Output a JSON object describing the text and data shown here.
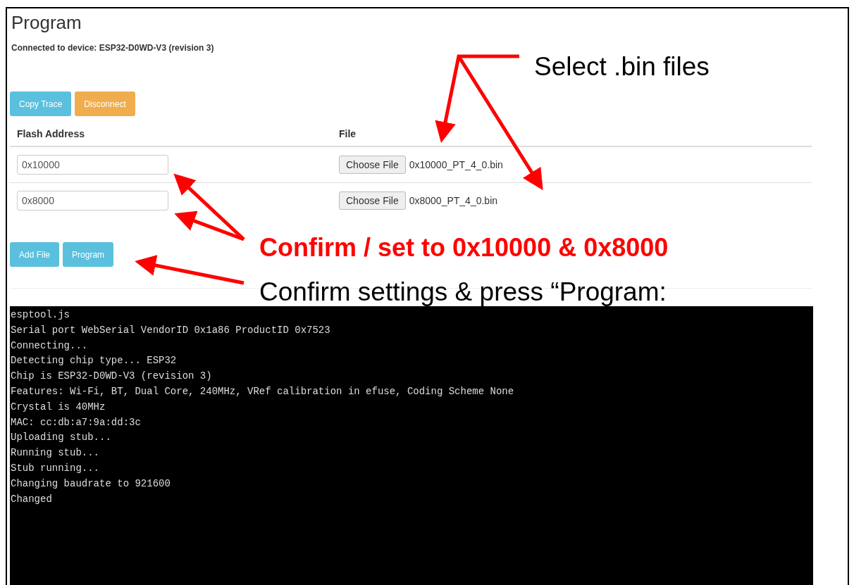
{
  "title": "Program",
  "connection_text": "Connected to device: ESP32-D0WD-V3 (revision 3)",
  "top_buttons": [
    {
      "label": "Copy Trace",
      "kind": "info"
    },
    {
      "label": "Disconnect",
      "kind": "warning"
    }
  ],
  "table": {
    "columns": [
      "Flash Address",
      "File"
    ],
    "rows": [
      {
        "address": "0x10000",
        "file_button": "Choose File",
        "file_name": "0x10000_PT_4_0.bin"
      },
      {
        "address": "0x8000",
        "file_button": "Choose File",
        "file_name": "0x8000_PT_4_0.bin"
      }
    ]
  },
  "bottom_buttons": [
    {
      "label": "Add File",
      "kind": "info"
    },
    {
      "label": "Program",
      "kind": "info"
    }
  ],
  "console_lines": [
    "esptool.js",
    "Serial port WebSerial VendorID 0x1a86 ProductID 0x7523",
    "Connecting...",
    "Detecting chip type... ESP32",
    "Chip is ESP32-D0WD-V3 (revision 3)",
    "Features: Wi-Fi, BT, Dual Core, 240MHz, VRef calibration in efuse, Coding Scheme None",
    "Crystal is 40MHz",
    "MAC: cc:db:a7:9a:dd:3c",
    "Uploading stub...",
    "Running stub...",
    "Stub running...",
    "Changing baudrate to 921600",
    "Changed"
  ],
  "annotations": [
    {
      "text": "Select .bin files",
      "kind": "plain"
    },
    {
      "text": "Confirm / set to 0x10000 & 0x8000",
      "kind": "emphasis"
    },
    {
      "text": "Confirm settings & press “Program:",
      "kind": "plain"
    }
  ]
}
